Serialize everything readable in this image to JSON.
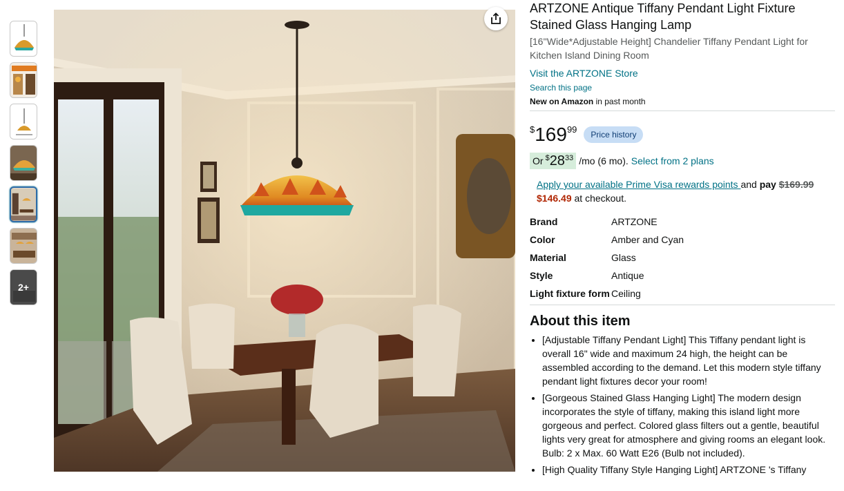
{
  "product": {
    "title": "ARTZONE Antique Tiffany Pendant Light Fixture Stained Glass Hanging Lamp",
    "subtitle": "[16''Wide*Adjustable Height] Chandelier Tiffany Pendant Light for Kitchen Island Dining Room",
    "store_link": "Visit the ARTZONE Store",
    "search_page": "Search this page",
    "new_on_amazon_bold": "New on Amazon",
    "new_on_amazon_rest": " in past month"
  },
  "thumbs": {
    "more_label": "2+"
  },
  "price": {
    "symbol": "$",
    "whole": "169",
    "fraction": "99",
    "history_label": "Price history"
  },
  "monthly": {
    "or": "Or",
    "symbol": "$",
    "whole": "28",
    "fraction": "33",
    "period": "/mo (6 mo).",
    "plans_link": "Select from 2 plans"
  },
  "rewards": {
    "link": "Apply your available Prime Visa rewards points ",
    "and": "and ",
    "pay": "pay",
    "old_price": "$169.99",
    "new_price": "$146.49",
    "at_checkout": " at checkout."
  },
  "specs": [
    {
      "key": "Brand",
      "value": "ARTZONE"
    },
    {
      "key": "Color",
      "value": "Amber and Cyan"
    },
    {
      "key": "Material",
      "value": "Glass"
    },
    {
      "key": "Style",
      "value": "Antique"
    },
    {
      "key": "Light fixture form",
      "value": "Ceiling"
    }
  ],
  "about": {
    "heading": "About this item",
    "bullets": [
      "[Adjustable Tiffany Pendant Light] This Tiffany pendant light is overall 16\" wide and maximum 24 high, the height can be assembled according to the demand. Let this modern style tiffany pendant light fixtures decor your room!",
      "[Gorgeous Stained Glass Hanging Light] The modern design incorporates the style of tiffany, making this island light more gorgeous and perfect. Colored glass filters out a gentle, beautiful lights very great for atmosphere and giving rooms an elegant look. Bulb: 2 x Max. 60 Watt E26 (Bulb not included).",
      "[High Quality Tiffany Style Hanging Light] ARTZONE 's Tiffany"
    ]
  },
  "colors": {
    "link": "#007185",
    "deal_red": "#b12704",
    "history_bg": "#c7ddf5",
    "monthly_bg": "#d6eddb"
  }
}
